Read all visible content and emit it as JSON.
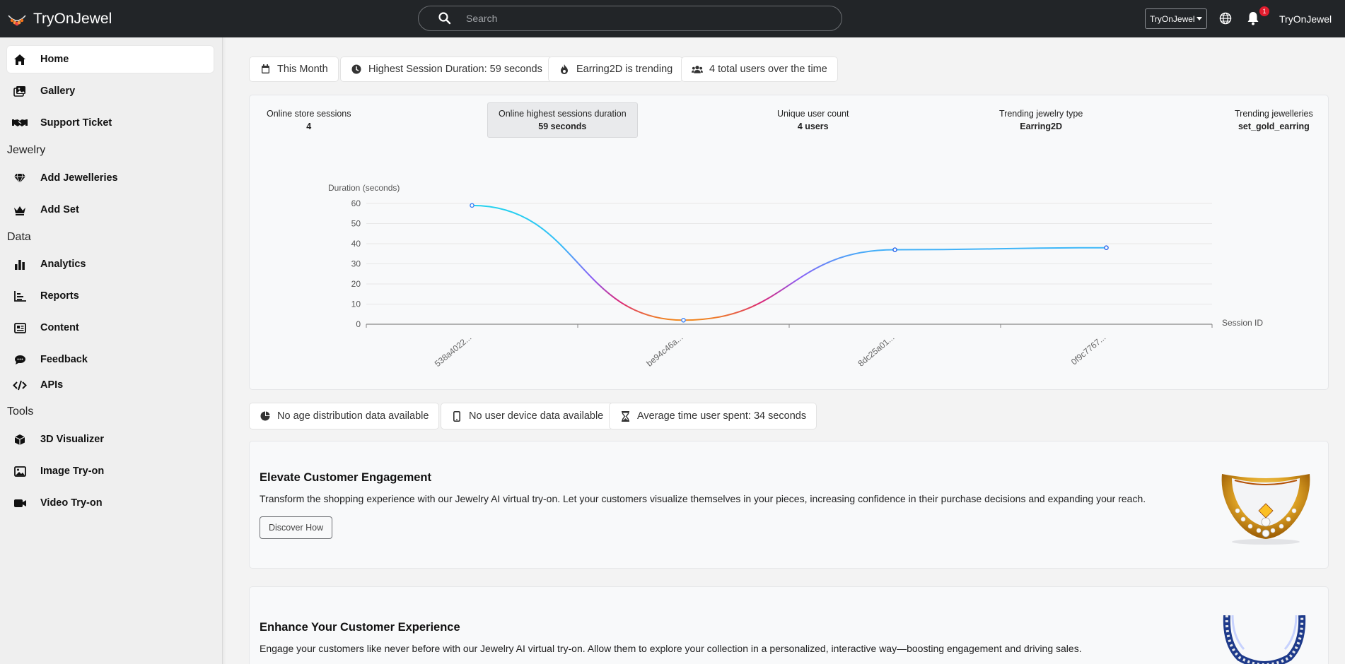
{
  "app": {
    "brand": "TryOnJewel",
    "search_placeholder": "Search",
    "tenant_selected": "TryOnJewel",
    "notification_count": "1",
    "user_name": "TryOnJewel"
  },
  "sidebar": {
    "items": [
      {
        "label": "Home",
        "icon": "home-icon",
        "active": true
      },
      {
        "label": "Gallery",
        "icon": "gallery-icon"
      },
      {
        "label": "Support Ticket",
        "icon": "handshake-icon"
      }
    ],
    "sections": [
      {
        "title": "Jewelry",
        "items": [
          {
            "label": "Add Jewelleries",
            "icon": "gem-icon"
          },
          {
            "label": "Add Set",
            "icon": "crown-icon"
          }
        ]
      },
      {
        "title": "Data",
        "items": [
          {
            "label": "Analytics",
            "icon": "bar-chart-icon"
          },
          {
            "label": "Reports",
            "icon": "report-chart-icon"
          },
          {
            "label": "Content",
            "icon": "newspaper-icon"
          },
          {
            "label": "Feedback",
            "icon": "comment-icon"
          },
          {
            "label": "APIs",
            "icon": "code-icon"
          }
        ]
      },
      {
        "title": "Tools",
        "items": [
          {
            "label": "3D Visualizer",
            "icon": "cube-icon"
          },
          {
            "label": "Image Try-on",
            "icon": "image-icon"
          },
          {
            "label": "Video Try-on",
            "icon": "video-icon"
          }
        ]
      }
    ]
  },
  "filters": [
    {
      "label": "This Month",
      "icon": "calendar-icon"
    },
    {
      "label": "Highest Session Duration: 59 seconds",
      "icon": "clock-icon"
    },
    {
      "label": "Earring2D is trending",
      "icon": "fire-icon"
    },
    {
      "label": "4 total users over the time",
      "icon": "users-icon"
    }
  ],
  "stats": [
    {
      "label": "Online store sessions",
      "value": "4"
    },
    {
      "label": "Online highest sessions duration",
      "value": "59 seconds",
      "active": true
    },
    {
      "label": "Unique user count",
      "value": "4 users"
    },
    {
      "label": "Trending jewelry type",
      "value": "Earring2D"
    },
    {
      "label": "Trending jewelleries",
      "value": "set_gold_earring"
    }
  ],
  "chart_data": {
    "type": "line",
    "ylabel": "Duration (seconds)",
    "xlabel": "Session ID",
    "categories": [
      "538a4022...",
      "be94c46a...",
      "8dc25a01...",
      "0f9c7767..."
    ],
    "values": [
      59,
      2,
      37,
      38
    ],
    "ylim": [
      0,
      60
    ],
    "yticks": [
      0,
      10,
      20,
      30,
      40,
      50,
      60
    ],
    "grid": true,
    "smooth": true
  },
  "info_pills": [
    {
      "label": "No age distribution data available",
      "icon": "pie-chart-icon"
    },
    {
      "label": "No user device data available",
      "icon": "mobile-icon"
    },
    {
      "label": "Average time user spent: 34 seconds",
      "icon": "hourglass-icon"
    }
  ],
  "promos": [
    {
      "title": "Elevate Customer Engagement",
      "text": "Transform the shopping experience with our Jewelry AI virtual try-on. Let your customers visualize themselves in your pieces, increasing confidence in their purchase decisions and expanding your reach.",
      "button": "Discover How"
    },
    {
      "title": "Enhance Your Customer Experience",
      "text": "Engage your customers like never before with our Jewelry AI virtual try-on. Allow them to explore your collection in a personalized, interactive way—boosting engagement and driving sales."
    }
  ],
  "colors": {
    "topbar": "#222528",
    "line_start": "#22d3ee",
    "line_mid": "#db2777",
    "line_low": "#f59e0b",
    "line_end": "#38bdf8"
  }
}
